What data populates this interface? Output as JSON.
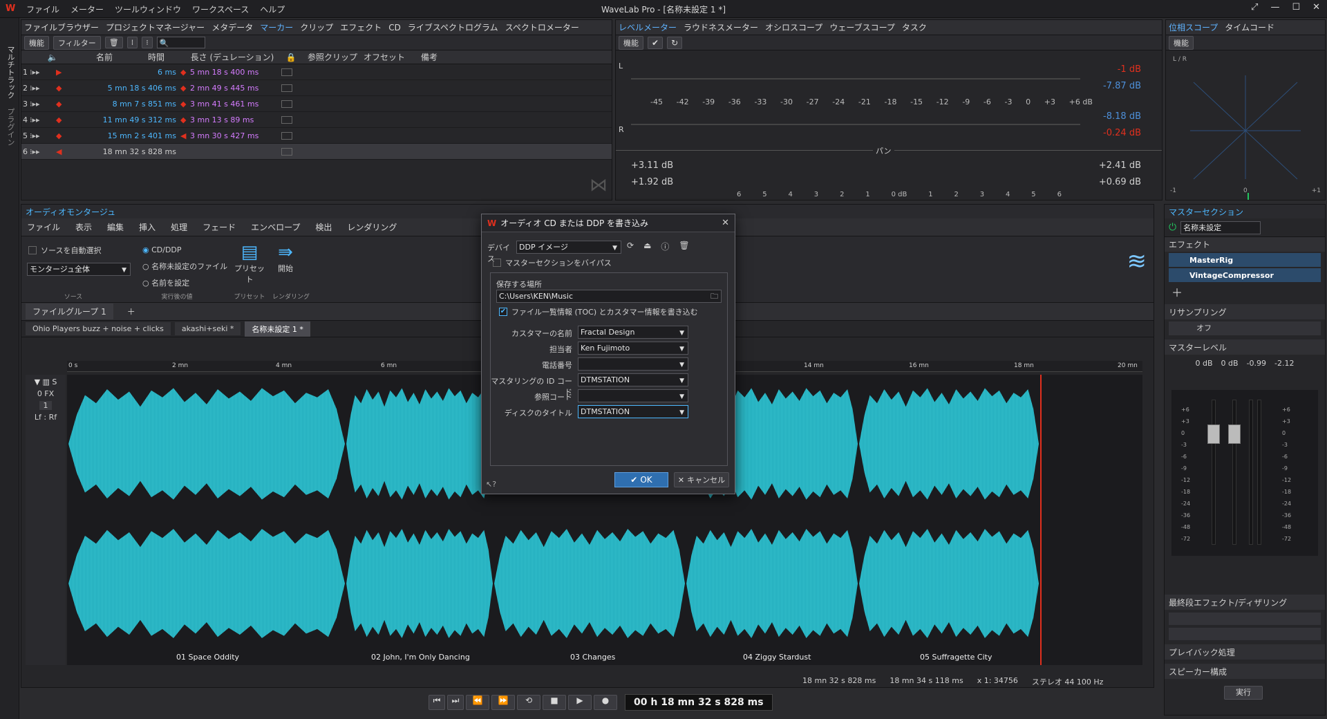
{
  "app": {
    "title": "WaveLab Pro - [名称未設定 1 *]",
    "menu": [
      "ファイル",
      "メーター",
      "ツールウィンドウ",
      "ワークスペース",
      "ヘルプ"
    ]
  },
  "left_strip": {
    "label1": "マルチトラック",
    "label2": "プラグイン"
  },
  "top_left_tabs": [
    "ファイルブラウザー",
    "プロジェクトマネージャー",
    "メタデータ",
    "マーカー",
    "クリップ",
    "エフェクト",
    "CD",
    "ライブスペクトログラム",
    "スペクトロメーター"
  ],
  "marker_toolbar": {
    "func": "機能",
    "filter": "フィルター"
  },
  "marker_table": {
    "headers": [
      "",
      "名前",
      "時間",
      "長さ (デュレーション)",
      "",
      "参照クリップ",
      "オフセット",
      "備考"
    ],
    "rows": [
      {
        "n": "1",
        "time": "6 ms",
        "len": "5 mn 18 s 400 ms"
      },
      {
        "n": "2",
        "time": "5 mn 18 s 406 ms",
        "len": "2 mn 49 s 445 ms"
      },
      {
        "n": "3",
        "time": "8 mn 7 s 851 ms",
        "len": "3 mn 41 s 461 ms"
      },
      {
        "n": "4",
        "time": "11 mn 49 s 312 ms",
        "len": "3 mn 13 s 89 ms"
      },
      {
        "n": "5",
        "time": "15 mn 2 s 401 ms",
        "len": "3 mn 30 s 427 ms"
      },
      {
        "n": "6",
        "time": "18 mn 32 s 828 ms",
        "len": ""
      }
    ]
  },
  "meter_tabs": [
    "レベルメーター",
    "ラウドネスメーター",
    "オシロスコープ",
    "ウェーブスコープ",
    "タスク"
  ],
  "level_meter": {
    "func": "機能",
    "ch_l": "L",
    "ch_r": "R",
    "scale": [
      "-45",
      "-42",
      "-39",
      "-36",
      "-33",
      "-30",
      "-27",
      "-24",
      "-21",
      "-18",
      "-15",
      "-12",
      "-9",
      "-6",
      "-3",
      "0",
      "+3",
      "+6 dB"
    ],
    "readings": [
      "-1 dB",
      "-7.87 dB",
      "-8.18 dB",
      "-0.24 dB"
    ],
    "pan_label": "パン",
    "pan_left": [
      "+3.11 dB",
      "+1.92 dB"
    ],
    "pan_right": [
      "+2.41 dB",
      "+0.69 dB"
    ],
    "pan_scale": [
      "6",
      "5",
      "4",
      "3",
      "2",
      "1",
      "0 dB",
      "1",
      "2",
      "3",
      "4",
      "5",
      "6"
    ]
  },
  "phase_tabs": [
    "位相スコープ",
    "タイムコード"
  ],
  "phase": {
    "func": "機能",
    "lr": "L / R",
    "min": "-1",
    "mid": "0",
    "max": "+1"
  },
  "montage": {
    "title": "オーディオモンタージュ",
    "tabs": [
      "ファイル",
      "表示",
      "編集",
      "挿入",
      "処理",
      "フェード",
      "エンベロープ",
      "検出",
      "レンダリング"
    ],
    "auto_select": "ソースを自動選択",
    "source_select": "モンタージュ全体",
    "options": [
      "CD/DDP",
      "名称未設定のファイル",
      "名前を設定"
    ],
    "preset": "プリセット",
    "start": "開始",
    "group_labels": [
      "ソース",
      "実行後の値",
      "プリセット",
      "レンダリング"
    ],
    "file_group": "ファイルグループ 1",
    "doc_tabs": [
      "Ohio Players buzz + noise + clicks",
      "akashi+seki *",
      "名称未設定 1 *"
    ],
    "ruler": [
      "0 s",
      "2 mn",
      "4 mn",
      "6 mn",
      "14 mn",
      "16 mn",
      "18 mn",
      "20 mn"
    ],
    "track": {
      "fx": "0 FX",
      "num": "1",
      "lr": "Lf : Rf"
    },
    "clips": [
      "01 Space Oddity",
      "02 John, I'm Only Dancing",
      "03 Changes",
      "04 Ziggy Stardust",
      "05 Suffragette City"
    ],
    "status": [
      "18 mn 32 s 828 ms",
      "18 mn 34 s 118 ms",
      "x 1: 34756",
      "ステレオ 44 100 Hz"
    ]
  },
  "transport": {
    "time": "00 h 18 mn 32 s 828 ms"
  },
  "dialog": {
    "title": "オーディオ CD または DDP を書き込み",
    "device_label": "デバイス",
    "device": "DDP イメージ",
    "bypass": "マスターセクションをバイパス",
    "save_label": "保存する場所",
    "save_path": "C:\\Users\\KEN\\Music",
    "toc": "ファイル一覧情報 (TOC) とカスタマー情報を書き込む",
    "fields": [
      {
        "label": "カスタマーの名前",
        "value": "Fractal Design"
      },
      {
        "label": "担当者",
        "value": "Ken Fujimoto"
      },
      {
        "label": "電話番号",
        "value": ""
      },
      {
        "label": "マスタリングの ID コード",
        "value": "DTMSTATION"
      },
      {
        "label": "参照コード",
        "value": ""
      },
      {
        "label": "ディスクのタイトル",
        "value": "DTMSTATION"
      }
    ],
    "ok": "OK",
    "cancel": "キャンセル"
  },
  "master": {
    "title": "マスターセクション",
    "preset": "名称未設定",
    "effects": "エフェクト",
    "plugins": [
      "MasterRig",
      "VintageCompressor"
    ],
    "resample": "リサンプリング",
    "resample_val": "オフ",
    "master_level": "マスターレベル",
    "levels": [
      "0 dB",
      "0 dB",
      "-0.99",
      "-2.12"
    ],
    "scale": [
      "+6",
      "+3",
      "0",
      "-3",
      "-6",
      "-9",
      "-12",
      "-18",
      "-24",
      "-36",
      "-48",
      "-72"
    ],
    "final": "最終段エフェクト/ディザリング",
    "playback": "プレイバック処理",
    "speaker": "スピーカー構成",
    "run": "実行"
  }
}
